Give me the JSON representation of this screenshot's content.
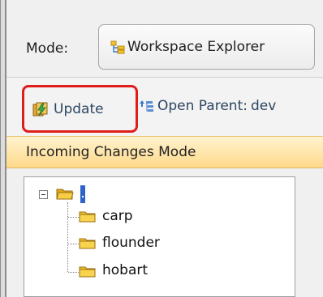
{
  "mode": {
    "label": "Mode:",
    "selected": "Workspace Explorer"
  },
  "toolbar": {
    "update_label": "Update",
    "open_parent_label": "Open Parent:",
    "open_parent_value": "dev"
  },
  "incoming": {
    "label": "Incoming Changes Mode"
  },
  "tree": {
    "root_label": ".",
    "children": [
      "carp",
      "flounder",
      "hobart"
    ]
  },
  "colors": {
    "highlight_border": "#e11c1c",
    "selection": "#2f63c9",
    "incoming_bar": "#ffd98a",
    "folder": "#f2c230"
  }
}
